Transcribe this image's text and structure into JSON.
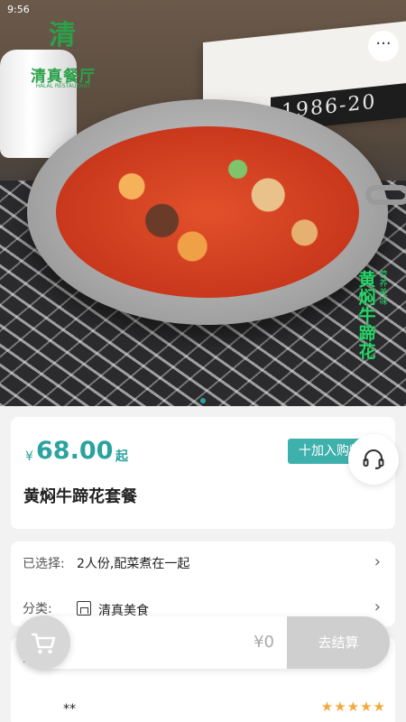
{
  "status_bar": {
    "time": "9:56"
  },
  "hero": {
    "logo_mark": "清",
    "logo_text": "清真餐厅",
    "logo_sub": "HALAL RESTAURANT",
    "book_number": "1986-20",
    "overlay_title": "黄焖牛蹄花",
    "overlay_sub": "营养美味"
  },
  "header": {
    "more_label": "···"
  },
  "product": {
    "currency": "¥",
    "price": "68.00",
    "price_suffix": "起",
    "add_to_cart_label": "十加入购物车",
    "name": "黄焖牛蹄花套餐"
  },
  "options": {
    "selected_label": "已选择:",
    "selected_value": "2人份,配菜煮在一起",
    "category_label": "分类:",
    "category_value": "清真美食"
  },
  "reviews": {
    "label_fragment": "A",
    "user": "**",
    "rating": 5,
    "stars": "★★★★★"
  },
  "cart": {
    "total": "¥0",
    "checkout_label": "去结算"
  },
  "colors": {
    "accent": "#3fb1ad",
    "price": "#2aa3a0",
    "star": "#f2a93b"
  }
}
